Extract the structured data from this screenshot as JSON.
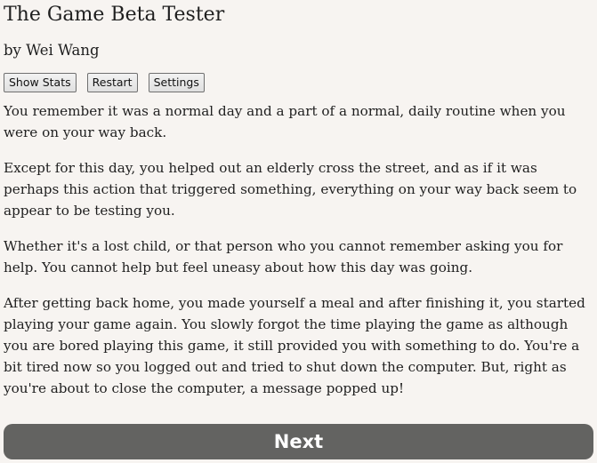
{
  "header": {
    "title": "The Game Beta Tester",
    "author": "by Wei Wang"
  },
  "toolbar": {
    "show_stats_label": "Show Stats",
    "restart_label": "Restart",
    "settings_label": "Settings"
  },
  "story": {
    "paragraphs": [
      "You remember it was a normal day and a part of a normal, daily routine when you were on your way back.",
      "Except for this day, you helped out an elderly cross the street, and as if it was perhaps this action that triggered something, everything on your way back seem to appear to be testing you.",
      "Whether it's a lost child, or that person who you cannot remember asking you for help. You cannot help but feel uneasy about how this day was going.",
      "After getting back home, you made yourself a meal and after finishing it, you started playing your game again. You slowly forgot the time playing the game as although you are bored playing this game, it still provided you with something to do. You're a bit tired now so you logged out and tried to shut down the computer. But, right as you're about to close the computer, a message popped up!"
    ]
  },
  "actions": {
    "next_label": "Next"
  },
  "colors": {
    "background": "#f7f4f1",
    "next_button": "#636361",
    "text": "#1f1f1f"
  }
}
